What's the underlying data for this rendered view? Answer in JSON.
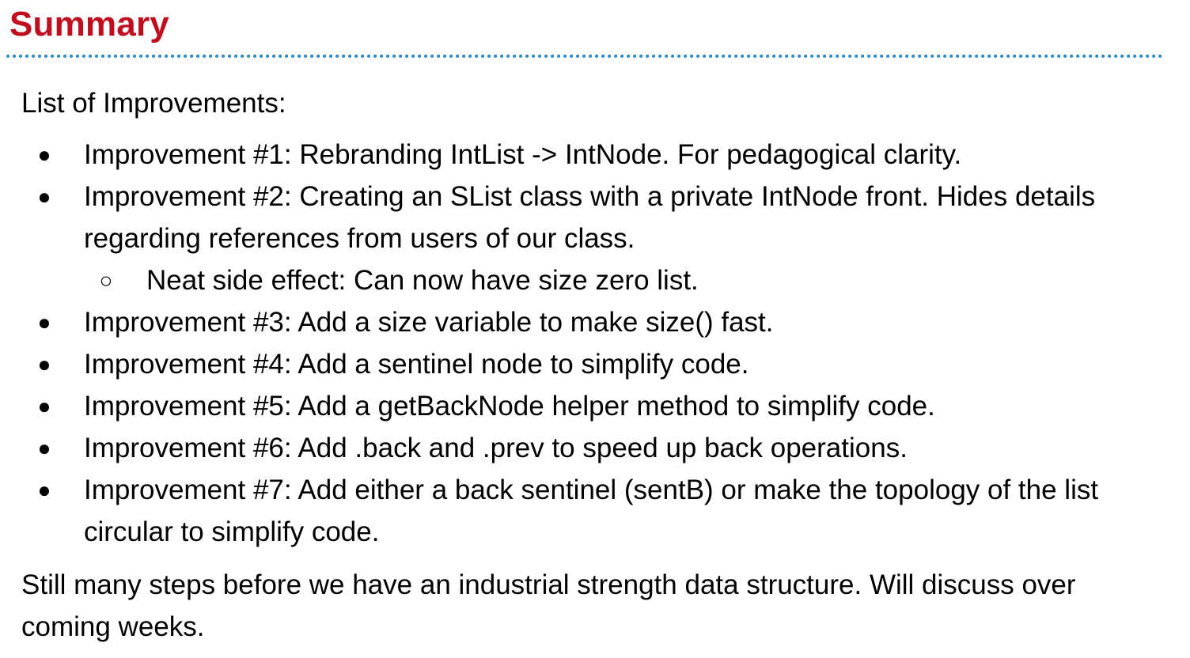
{
  "slide": {
    "title": "Summary",
    "intro": "List of Improvements:",
    "bullets": [
      {
        "marker": "●",
        "text": "Improvement #1: Rebranding IntList -> IntNode. For pedagogical clarity."
      },
      {
        "marker": "●",
        "text": "Improvement #2: Creating an SList class with a private IntNode front. Hides details regarding references from users of our class."
      },
      {
        "marker": "○",
        "text": "Neat side effect: Can now have size zero list."
      },
      {
        "marker": "●",
        "text": "Improvement #3: Add a size variable to make size() fast."
      },
      {
        "marker": "●",
        "text": "Improvement #4: Add a sentinel node to simplify code."
      },
      {
        "marker": "●",
        "text": "Improvement #5: Add a getBackNode helper method to simplify code."
      },
      {
        "marker": "●",
        "text": "Improvement #6: Add .back and .prev to speed up back operations."
      },
      {
        "marker": "●",
        "text": "Improvement #7: Add either a back sentinel (sentB) or make the topology of the list circular to simplify code."
      }
    ],
    "closing": "Still many steps before we have an industrial strength data structure. Will discuss over coming weeks."
  },
  "colors": {
    "title": "#c00e1f",
    "rule": "#2e89c9",
    "text": "#000000"
  }
}
